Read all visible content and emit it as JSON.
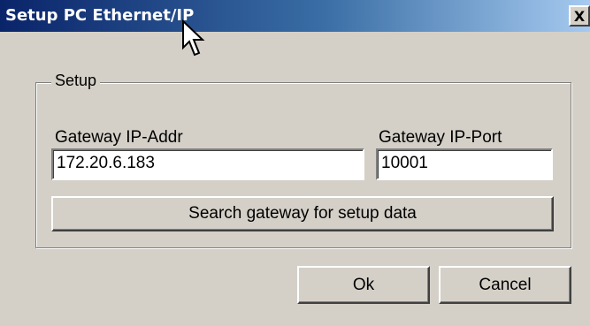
{
  "window": {
    "title": "Setup PC Ethernet/IP",
    "close_label": "X"
  },
  "setup": {
    "group_label": "Setup",
    "gateway_ip_label": "Gateway IP-Addr",
    "gateway_ip_value": "172.20.6.183",
    "gateway_port_label": "Gateway IP-Port",
    "gateway_port_value": "10001",
    "search_button_label": "Search gateway for setup data"
  },
  "buttons": {
    "ok_label": "Ok",
    "cancel_label": "Cancel"
  },
  "icons": {
    "close": "close-icon",
    "cursor": "mouse-pointer-icon"
  },
  "colors": {
    "titlebar_start": "#0a246a",
    "titlebar_end": "#a6caf0",
    "dialog_face": "#d4d0c8"
  }
}
